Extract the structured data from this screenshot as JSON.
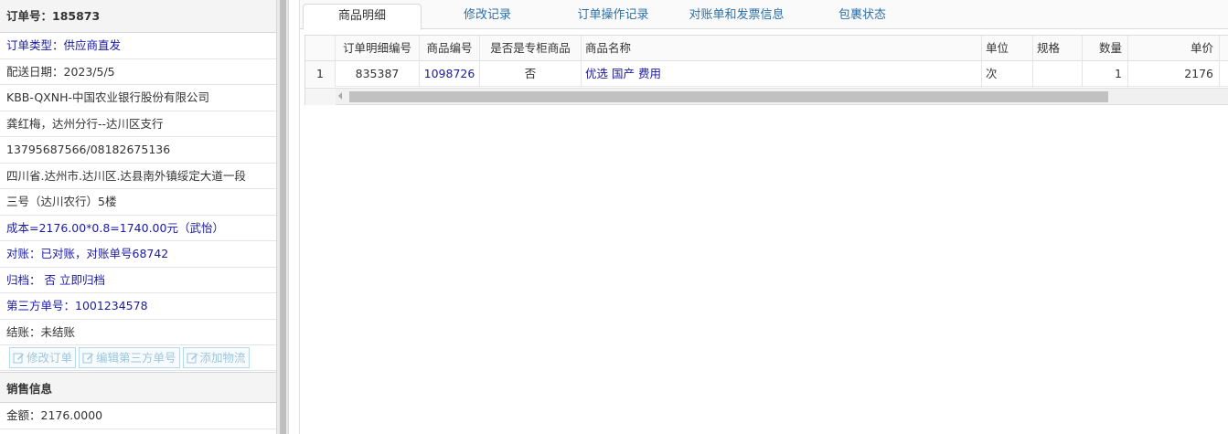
{
  "left": {
    "order_no_label": "订单号：185873",
    "rows": [
      {
        "text": "订单类型：供应商直发",
        "color": "blue"
      },
      {
        "text": "配送日期：2023/5/5",
        "color": "plain"
      },
      {
        "text": "KBB-QXNH-中国农业银行股份有限公司",
        "color": "plain"
      },
      {
        "text": "龚红梅，达州分行--达川区支行",
        "color": "plain"
      },
      {
        "text": "13795687566/08182675136",
        "color": "plain"
      },
      {
        "text": "四川省.达州市.达川区.达县南外镇绥定大道一段",
        "color": "plain"
      },
      {
        "text": "三号（达川农行）5楼",
        "color": "plain"
      },
      {
        "text": "成本=2176.00*0.8=1740.00元（武怡）",
        "color": "blue"
      },
      {
        "text": "对账：已对账，对账单号68742",
        "color": "blue"
      },
      {
        "text": "归档： 否 立即归档",
        "color": "blue"
      },
      {
        "text": "第三方单号：1001234578",
        "color": "blue"
      },
      {
        "text": "结账：未结账",
        "color": "plain"
      }
    ],
    "buttons": [
      {
        "label": "修改订单",
        "icon": "edit-icon"
      },
      {
        "label": "编辑第三方单号",
        "icon": "edit-icon"
      },
      {
        "label": "添加物流",
        "icon": "edit-icon"
      }
    ],
    "sales_header": "销售信息",
    "amount": "金额：2176.0000"
  },
  "tabs": [
    {
      "label": "商品明细",
      "active": true
    },
    {
      "label": "修改记录",
      "active": false
    },
    {
      "label": "订单操作记录",
      "active": false
    },
    {
      "label": "对账单和发票信息",
      "active": false
    },
    {
      "label": "包裹状态",
      "active": false
    }
  ],
  "grid": {
    "columns": [
      "",
      "订单明细编号",
      "商品编号",
      "是否是专柜商品",
      "商品名称",
      "单位",
      "规格",
      "数量",
      "单价"
    ],
    "rows": [
      [
        "1",
        "835387",
        "1098726",
        "否",
        "优选 国产 费用",
        "次",
        "",
        "1",
        "2176"
      ]
    ]
  },
  "colors": {
    "link": "#1a1aa6",
    "tab_text": "#2b6fa8",
    "button_border": "#b8d9ea"
  }
}
